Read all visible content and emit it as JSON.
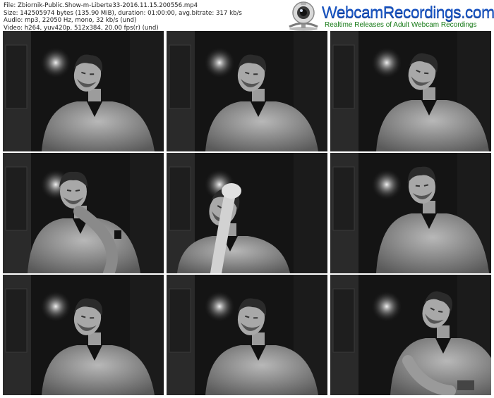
{
  "file_info": {
    "file": "File: Zbiornik-Public.Show-m-Liberte33-2016.11.15.200556.mp4",
    "size": "Size: 142505974 bytes (135.90 MiB), duration: 01:00:00, avg.bitrate: 317 kb/s",
    "audio": "Audio: mp3, 22050 Hz, mono, 32 kb/s (und)",
    "video": "Video: h264, yuv420p, 512x384, 20.00 fps(r) (und)"
  },
  "logo": {
    "title": "WebcamRecordings.com",
    "tagline": "Realtime Releases of Adult Webcam Recordings",
    "icon": "webcam-icon"
  },
  "thumbnails": [
    {
      "pose": "looking-down"
    },
    {
      "pose": "looking-down"
    },
    {
      "pose": "looking-down-right"
    },
    {
      "pose": "hand-on-chin"
    },
    {
      "pose": "hand-on-head"
    },
    {
      "pose": "looking-left"
    },
    {
      "pose": "looking-down"
    },
    {
      "pose": "looking-down"
    },
    {
      "pose": "reaching-down"
    }
  ]
}
